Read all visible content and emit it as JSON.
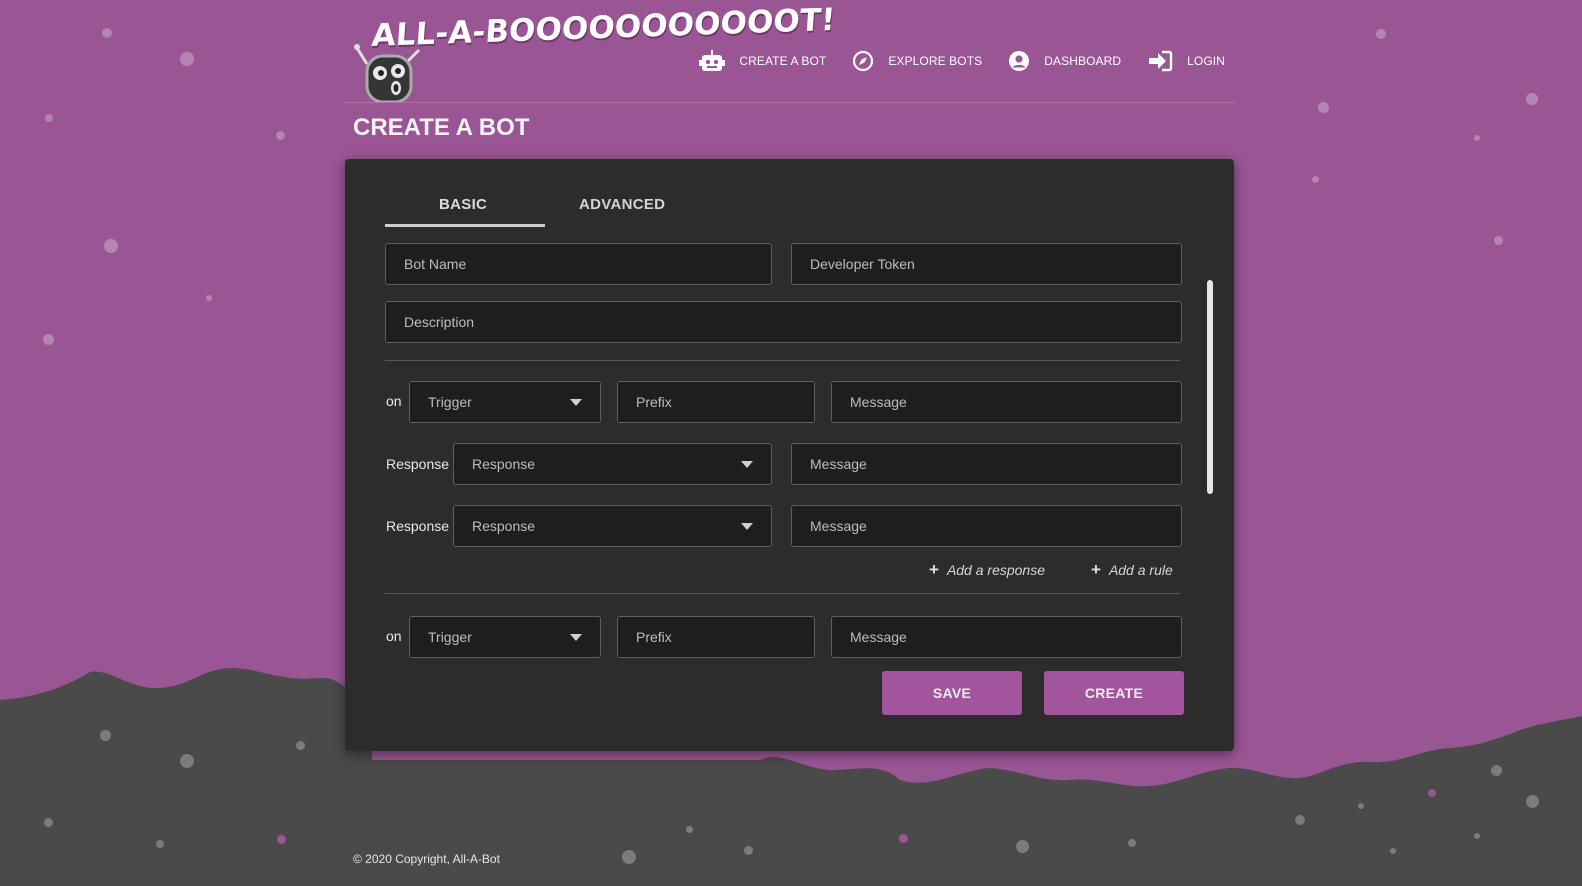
{
  "brand": {
    "logo_text": "ALL-A-BOOOOOOOOOOOT!"
  },
  "nav": {
    "items": [
      {
        "label": "CREATE A BOT",
        "icon": "robot-icon"
      },
      {
        "label": "EXPLORE BOTS",
        "icon": "compass-icon"
      },
      {
        "label": "DASHBOARD",
        "icon": "user-circle-icon"
      },
      {
        "label": "LOGIN",
        "icon": "login-icon"
      }
    ]
  },
  "page": {
    "title": "CREATE A BOT"
  },
  "tabs": [
    {
      "label": "BASIC",
      "active": true
    },
    {
      "label": "ADVANCED",
      "active": false
    }
  ],
  "form": {
    "bot_name": {
      "placeholder": "Bot Name",
      "value": ""
    },
    "developer_token": {
      "placeholder": "Developer Token",
      "value": ""
    },
    "description": {
      "placeholder": "Description",
      "value": ""
    },
    "rules": [
      {
        "on_label": "on",
        "trigger": "Trigger",
        "prefix": "Prefix",
        "message": "Message",
        "responses": [
          {
            "label": "Response",
            "select": "Response",
            "message": "Message"
          },
          {
            "label": "Response",
            "select": "Response",
            "message": "Message"
          }
        ],
        "add_response": "Add a response",
        "add_rule": "Add a rule"
      },
      {
        "on_label": "on",
        "trigger": "Trigger",
        "prefix": "Prefix",
        "message": "Message"
      }
    ]
  },
  "actions": {
    "save": "SAVE",
    "create": "CREATE"
  },
  "footer": {
    "copyright": "© 2020 Copyright, All-A-Bot"
  },
  "colors": {
    "background": "#9a5594",
    "hills": "#4a4a4a",
    "card": "#2c2c2c",
    "accent": "#a2559c"
  }
}
